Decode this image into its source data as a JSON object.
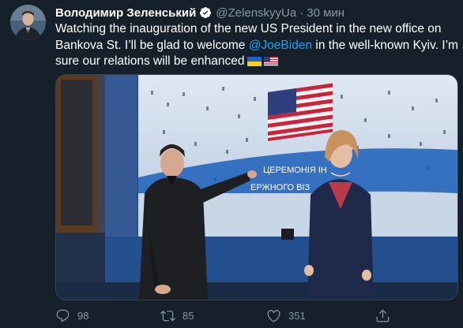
{
  "tweet": {
    "display_name": "Володимир Зеленський",
    "handle": "@ZelenskyyUa",
    "separator": "·",
    "time": "30 мин",
    "text_part1": "Watching the inauguration of the new US President in the new office on Bankova St. I’ll be glad to welcome ",
    "mention": "@JoeBiden",
    "text_part2": " in the well-known Kyiv. I’m sure our relations will be enhanced",
    "flags": [
      "ukraine-flag",
      "us-flag"
    ],
    "screen_text_line1": "ЦЕРЕМОНІЯ ІН",
    "screen_text_line2": "ЕРЖНОГО ВІЗ"
  },
  "actions": {
    "replies": "98",
    "retweets": "85",
    "likes": "351"
  },
  "colors": {
    "background": "#15202b",
    "secondary_text": "#8899a6",
    "accent": "#1da1f2"
  },
  "icons": [
    "verified-icon",
    "reply-icon",
    "retweet-icon",
    "like-icon",
    "share-icon"
  ]
}
